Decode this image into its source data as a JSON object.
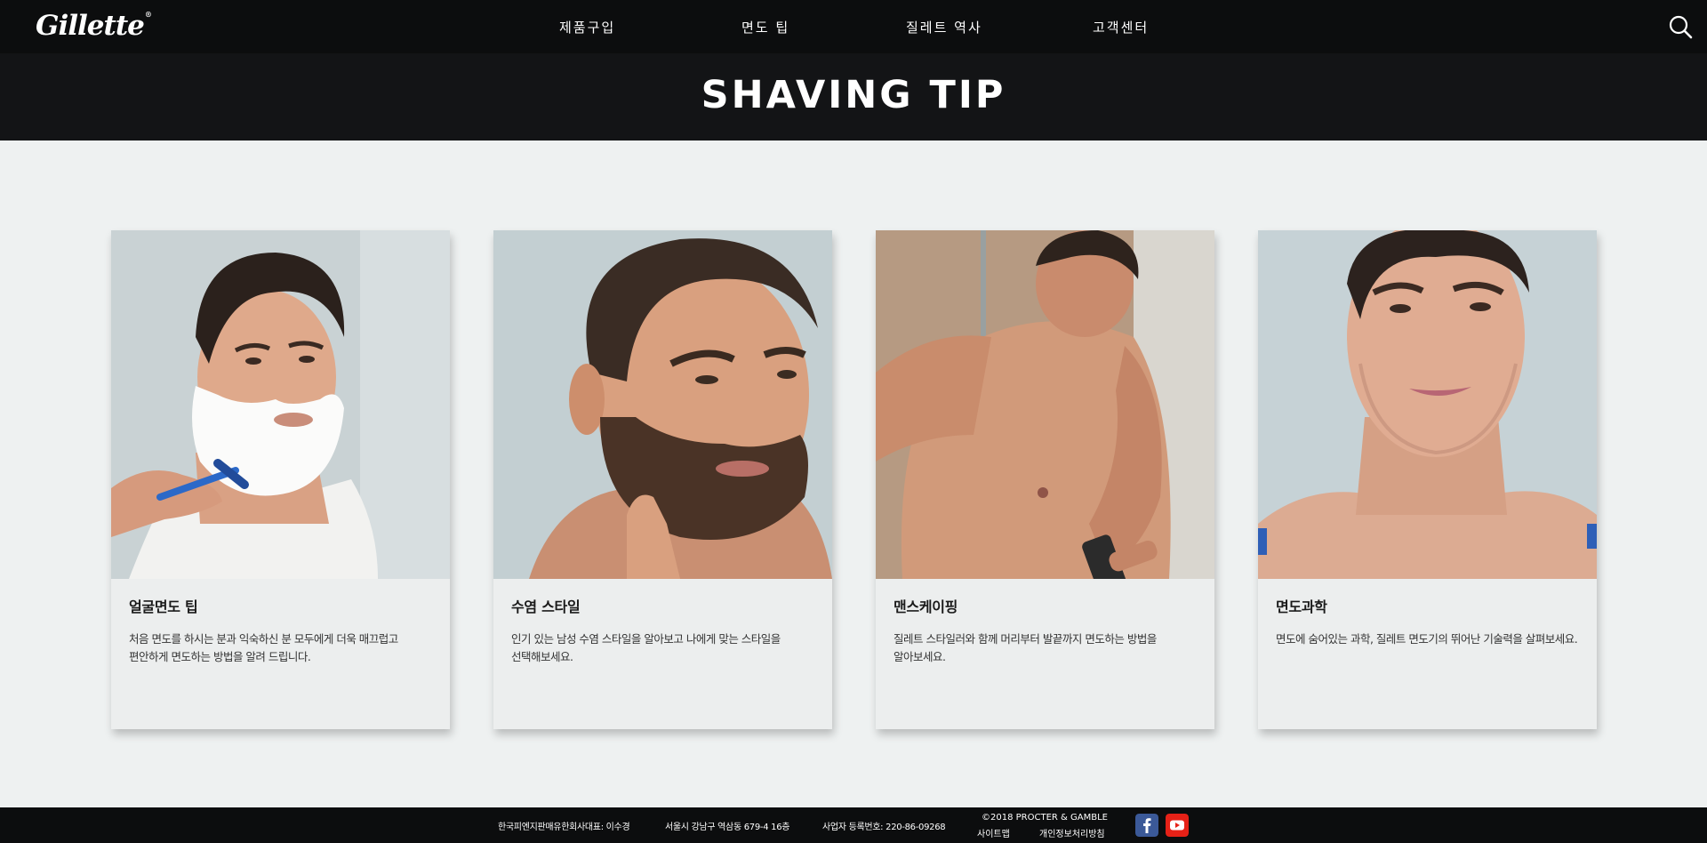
{
  "header": {
    "logo": "Gillette",
    "nav": [
      "제품구입",
      "면도 팁",
      "질레트 역사",
      "고객센터"
    ],
    "search_icon": "search-icon"
  },
  "page": {
    "title": "SHAVING TIP"
  },
  "cards": [
    {
      "title": "얼굴면도 팁",
      "desc": "처음 면도를 하시는 분과 익숙하신 분 모두에게 더욱 매끄럽고 편안하게 면도하는 방법을 알려 드립니다."
    },
    {
      "title": "수염 스타일",
      "desc": "인기 있는 남성 수염 스타일을 알아보고 나에게 맞는 스타일을 선택해보세요."
    },
    {
      "title": "맨스케이핑",
      "desc": "질레트 스타일러와 함께 머리부터 발끝까지 면도하는 방법을 알아보세요."
    },
    {
      "title": "면도과학",
      "desc": "면도에 숨어있는 과학, 질레트 면도기의 뛰어난 기술력을 살펴보세요."
    }
  ],
  "footer": {
    "company": "한국피엔지판매유한회사대표: 이수경",
    "address": "서울시 강남구 역삼동 679-4 16층",
    "biz_no": "사업자 등록번호: 220-86-09268",
    "copyright": "©2018 PROCTER & GAMBLE",
    "sitemap": "사이트맵",
    "privacy": "개인정보처리방침",
    "social": [
      "facebook-icon",
      "youtube-icon"
    ]
  },
  "colors": {
    "header_bg": "#0c0d0e",
    "page_bg": "#eef1f1",
    "card_bg": "#eceeee",
    "facebook": "#3b5998",
    "youtube": "#e62117"
  }
}
